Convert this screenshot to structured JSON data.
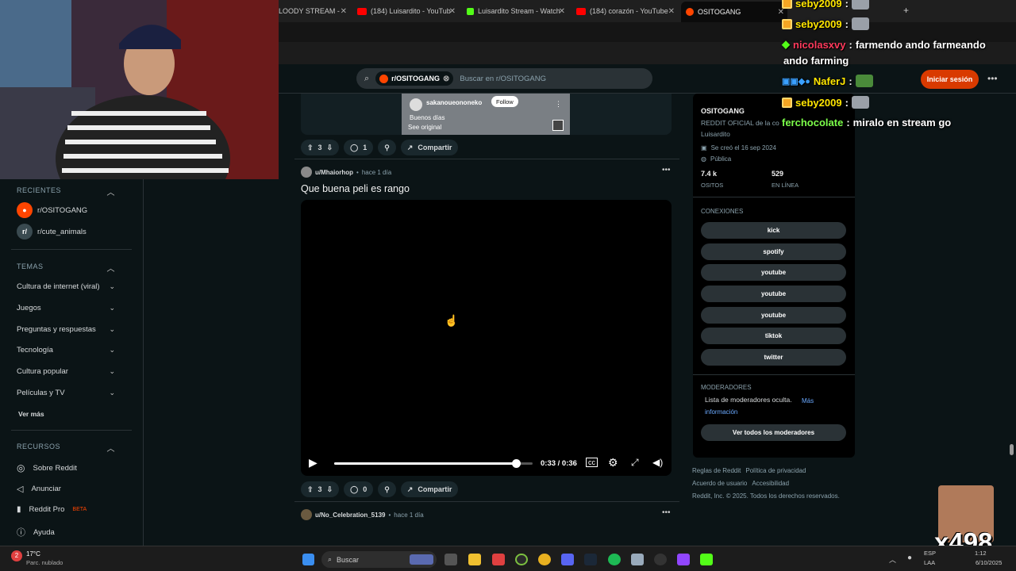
{
  "tabs": [
    {
      "label": "LOODY STREAM -",
      "color": "#444"
    },
    {
      "label": "(184) Luisardito - YouTub",
      "color": "#ff0000"
    },
    {
      "label": "Luisardito Stream - Watch",
      "color": "#53fc18"
    },
    {
      "label": "(184) corazón - YouTube",
      "color": "#ff0000"
    },
    {
      "label": "OSITOGANG",
      "color": "#ff4500"
    }
  ],
  "header": {
    "search_chip": "r/OSITOGANG",
    "search_placeholder": "Buscar en r/OSITOGANG",
    "login_label": "Iniciar sesión"
  },
  "sidebar": {
    "recientes_label": "RECIENTES",
    "recientes": [
      "r/OSITOGANG",
      "r/cute_animals"
    ],
    "temas_label": "TEMAS",
    "temas": [
      "Cultura de internet (viral)",
      "Juegos",
      "Preguntas y respuestas",
      "Tecnología",
      "Cultura popular",
      "Películas y TV"
    ],
    "ver_mas": "Ver más",
    "recursos_label": "RECURSOS",
    "recursos": [
      "Sobre Reddit",
      "Anunciar",
      "Reddit Pro",
      "Ayuda"
    ],
    "beta": "BETA"
  },
  "posts": [
    {
      "embed_user": "sakanoueononeko",
      "embed_follow": "Follow",
      "embed_text": "Buenos días",
      "embed_see": "See original",
      "votes": "3",
      "comments": "1",
      "share": "Compartir"
    },
    {
      "user": "u/Mhaiorhop",
      "time": "hace 1 día",
      "title": "Que buena peli es rango",
      "video_time": "0:33 / 0:36",
      "progress": 0.917,
      "votes": "3",
      "comments": "0",
      "share": "Compartir"
    },
    {
      "user": "u/No_Celebration_5139",
      "time": "hace 1 día"
    }
  ],
  "community": {
    "name": "OSITOGANG",
    "description": "REDDIT OFICIAL de la co",
    "description2": "Luisardito",
    "created": "Se creó el 16 sep 2024",
    "visibility": "Pública",
    "members_value": "7.4 k",
    "members_label": "OSITOS",
    "online_value": "529",
    "online_label": "EN LÍNEA",
    "connections_label": "CONEXIONES",
    "connections": [
      "kick",
      "spotify",
      "youtube",
      "youtube",
      "youtube",
      "tiktok",
      "twitter"
    ],
    "mods_label": "MODERADORES",
    "mods_text": "Lista de moderadores oculta.",
    "mods_link": "Más información",
    "mods_button": "Ver todos los moderadores"
  },
  "footer": {
    "line1a": "Reglas de Reddit",
    "line1b": "Política de privacidad",
    "line2a": "Acuerdo de usuario",
    "line2b": "Accesibilidad",
    "line3": "Reddit, Inc. © 2025. Todos los derechos reservados."
  },
  "chat": [
    {
      "user": "seby2009",
      "sep": ":",
      "text": "",
      "color": "#ffe600"
    },
    {
      "user": "seby2009",
      "sep": ":",
      "text": "",
      "color": "#ffe600"
    },
    {
      "user": "nicolasxvy",
      "sep": ":",
      "text": "farmendo ando farmeando",
      "color": "#ff3a5c"
    },
    {
      "user": "",
      "sep": "",
      "text": "ando farming",
      "color": "#ffffff"
    },
    {
      "user": "NaferJ",
      "sep": ":",
      "text": "",
      "color": "#ffe600"
    },
    {
      "user": "seby2009",
      "sep": ":",
      "text": "",
      "color": "#ffe600"
    },
    {
      "user": "ferchocolate",
      "sep": ":",
      "text": "miralo en stream go",
      "color": "#7cff4a"
    }
  ],
  "overlay_counter": "x498",
  "taskbar": {
    "temp": "17°C",
    "weather": "Parc. nublado",
    "search": "Buscar",
    "lang1": "ESP",
    "lang2": "LAA",
    "time": "1:12",
    "date": "6/10/2025"
  }
}
